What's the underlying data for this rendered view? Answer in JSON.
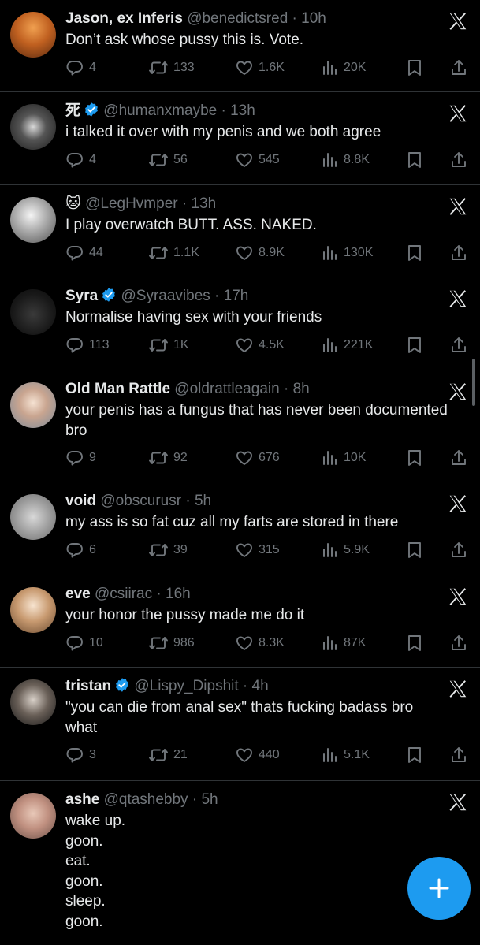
{
  "tweets": [
    {
      "name": "Jason, ex Inferis",
      "handle": "@benedictsred",
      "time": "10h",
      "text": "Don’t ask whose pussy this is. Vote.",
      "replies": "4",
      "retweets": "133",
      "likes": "1.6K",
      "views": "20K",
      "verified": false
    },
    {
      "name": "死",
      "handle": "@humanxmaybe",
      "time": "13h",
      "text": "i talked it over with my penis and we both agree",
      "replies": "4",
      "retweets": "56",
      "likes": "545",
      "views": "8.8K",
      "verified": true
    },
    {
      "name": "🐱",
      "handle": "@LegHvmper",
      "time": "13h",
      "text": "I play overwatch BUTT. ASS. NAKED.",
      "replies": "44",
      "retweets": "1.1K",
      "likes": "8.9K",
      "views": "130K",
      "verified": false
    },
    {
      "name": "Syra",
      "handle": "@Syraavibes",
      "time": "17h",
      "text": "Normalise having sex with your friends",
      "replies": "113",
      "retweets": "1K",
      "likes": "4.5K",
      "views": "221K",
      "verified": true
    },
    {
      "name": "Old Man Rattle",
      "handle": "@oldrattleagain",
      "time": "8h",
      "text": "your penis has a fungus that has never been documented bro",
      "replies": "9",
      "retweets": "92",
      "likes": "676",
      "views": "10K",
      "verified": false
    },
    {
      "name": "void",
      "handle": "@obscurusr",
      "time": "5h",
      "text": "my ass is so fat cuz all my farts are stored in there",
      "replies": "6",
      "retweets": "39",
      "likes": "315",
      "views": "5.9K",
      "verified": false
    },
    {
      "name": "eve",
      "handle": "@csiirac",
      "time": "16h",
      "text": "your honor the pussy made me do it",
      "replies": "10",
      "retweets": "986",
      "likes": "8.3K",
      "views": "87K",
      "verified": false
    },
    {
      "name": "tristan",
      "handle": "@Lispy_Dipshit",
      "time": "4h",
      "text": "\"you can die from anal sex\" thats fucking badass bro what",
      "replies": "3",
      "retweets": "21",
      "likes": "440",
      "views": "5.1K",
      "verified": true
    },
    {
      "name": "ashe",
      "handle": "@qtashebby",
      "time": "5h",
      "text": "wake up.\ngoon.\neat.\ngoon.\nsleep.\ngoon.",
      "replies": "",
      "retweets": "",
      "likes": "",
      "views": "",
      "verified": false
    }
  ],
  "separator": " · ",
  "icons": {
    "reply": "reply-icon",
    "retweet": "retweet-icon",
    "like": "heart-icon",
    "views": "views-icon",
    "bookmark": "bookmark-icon",
    "share": "share-icon",
    "x": "x-logo-icon",
    "compose": "plus-icon"
  },
  "colors": {
    "background": "#000000",
    "text": "#e7e9ea",
    "muted": "#71767b",
    "accent": "#1d9bf0",
    "divider": "#2f3336"
  }
}
